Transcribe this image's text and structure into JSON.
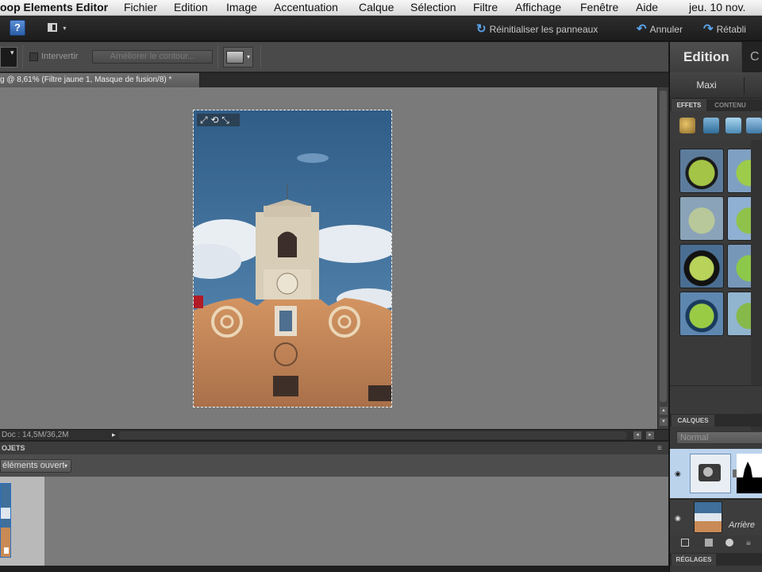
{
  "menubar": {
    "app_name": "oop Elements Editor",
    "items": [
      "Fichier",
      "Edition",
      "Image",
      "Accentuation",
      "Calque",
      "Sélection",
      "Filtre",
      "Affichage",
      "Fenêtre",
      "Aide"
    ],
    "clock": "jeu. 10 nov."
  },
  "appbar": {
    "help_label": "?",
    "reset_panels": "Réinitialiser les panneaux",
    "undo": "Annuler",
    "redo": "Rétabli"
  },
  "options": {
    "invert_label": "Intervertir",
    "refine_edge": "Améliorer le contour..."
  },
  "document": {
    "tab_title": "g @ 8,61% (Filtre jaune 1, Masque de fusion/8) *"
  },
  "status": {
    "doc_size": "Doc : 14,5M/36,2M"
  },
  "bin": {
    "title": "OJETS",
    "filter": "éléments ouvert"
  },
  "panel": {
    "tab_active": "Edition",
    "tab_next": "C",
    "mode": "Maxi",
    "fx_tabs": [
      "EFFETS",
      "CONTENU"
    ],
    "layers_title": "CALQUES",
    "blend_mode": "Normal",
    "background_layer": "Arrière",
    "adjustments_title": "RÉGLAGES"
  },
  "colors": {
    "accent": "#5aa4ec",
    "selected_layer": "#bcd3ec",
    "sky": "#3f6f9a",
    "facade": "#c98a55"
  }
}
